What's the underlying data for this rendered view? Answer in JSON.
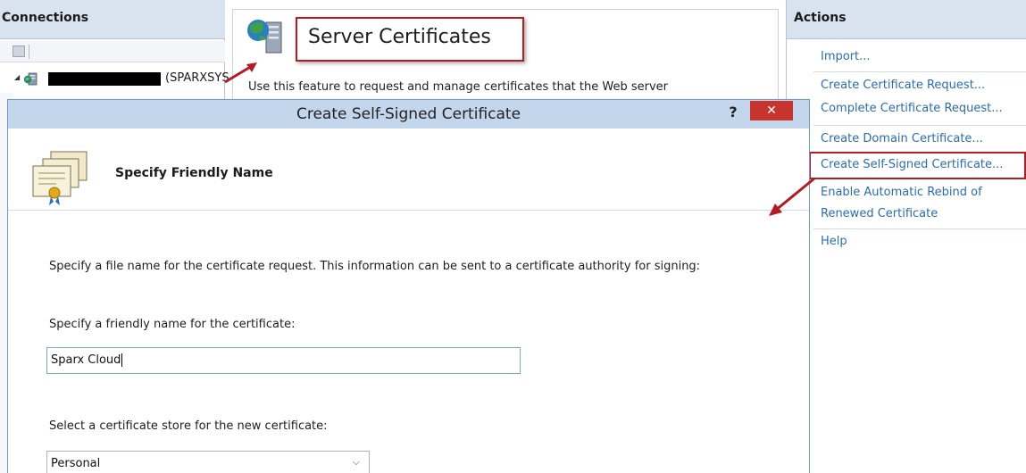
{
  "connections": {
    "title": "Connections",
    "server_node": {
      "label": "(SPARXSYS"
    }
  },
  "feature": {
    "title": "Server Certificates",
    "description": "Use this feature to request and manage certificates that the Web server"
  },
  "actions": {
    "title": "Actions",
    "items": [
      {
        "label": "Import..."
      },
      {
        "label": "Create Certificate Request..."
      },
      {
        "label": "Complete Certificate Request..."
      },
      {
        "label": "Create Domain Certificate..."
      },
      {
        "label": "Create Self-Signed Certificate..."
      },
      {
        "label": "Enable Automatic Rebind of"
      },
      {
        "label": "Renewed Certificate"
      },
      {
        "label": "Help"
      }
    ]
  },
  "dialog": {
    "title": "Create Self-Signed Certificate",
    "help": "?",
    "close": "✕",
    "step_title": "Specify Friendly Name",
    "intro": "Specify a file name for the certificate request.  This information can be sent to a certificate authority for signing:",
    "friendly_label": "Specify a friendly name for the certificate:",
    "friendly_value": "Sparx Cloud",
    "store_label": "Select a certificate store for the new certificate:",
    "store_value": "Personal"
  },
  "colors": {
    "accent_red": "#b31c24",
    "link_blue": "#2b6dad",
    "pane_header": "#d9e3ef",
    "dialog_title_bg": "#c4d6ec",
    "close_red": "#c7342f"
  },
  "icons": [
    "server-icon",
    "certificate-icon",
    "globe-server-icon",
    "chevron-down-icon"
  ]
}
